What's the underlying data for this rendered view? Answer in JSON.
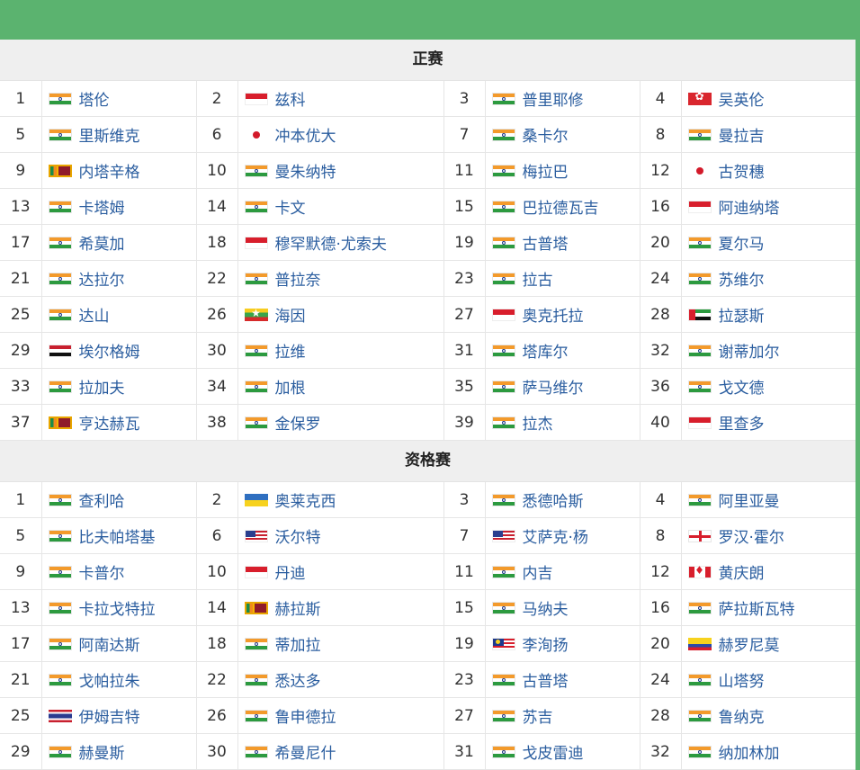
{
  "main_draw": {
    "title": "正赛",
    "players": [
      {
        "seed": "1",
        "name": "塔伦",
        "flag": "india"
      },
      {
        "seed": "2",
        "name": "兹科",
        "flag": "indonesia"
      },
      {
        "seed": "3",
        "name": "普里耶修",
        "flag": "india"
      },
      {
        "seed": "4",
        "name": "吴英伦",
        "flag": "hongkong"
      },
      {
        "seed": "5",
        "name": "里斯维克",
        "flag": "india"
      },
      {
        "seed": "6",
        "name": "冲本优大",
        "flag": "japan"
      },
      {
        "seed": "7",
        "name": "桑卡尔",
        "flag": "india"
      },
      {
        "seed": "8",
        "name": "曼拉吉",
        "flag": "india"
      },
      {
        "seed": "9",
        "name": "内塔辛格",
        "flag": "srilanka"
      },
      {
        "seed": "10",
        "name": "曼朱纳特",
        "flag": "india"
      },
      {
        "seed": "11",
        "name": "梅拉巴",
        "flag": "india"
      },
      {
        "seed": "12",
        "name": "古贺穗",
        "flag": "japan"
      },
      {
        "seed": "13",
        "name": "卡塔姆",
        "flag": "india"
      },
      {
        "seed": "14",
        "name": "卡文",
        "flag": "india"
      },
      {
        "seed": "15",
        "name": "巴拉德瓦吉",
        "flag": "india"
      },
      {
        "seed": "16",
        "name": "阿迪纳塔",
        "flag": "indonesia"
      },
      {
        "seed": "17",
        "name": "希莫加",
        "flag": "india"
      },
      {
        "seed": "18",
        "name": "穆罕默德·尤索夫",
        "flag": "indonesia"
      },
      {
        "seed": "19",
        "name": "古普塔",
        "flag": "india"
      },
      {
        "seed": "20",
        "name": "夏尔马",
        "flag": "india"
      },
      {
        "seed": "21",
        "name": "达拉尔",
        "flag": "india"
      },
      {
        "seed": "22",
        "name": "普拉奈",
        "flag": "india"
      },
      {
        "seed": "23",
        "name": "拉古",
        "flag": "india"
      },
      {
        "seed": "24",
        "name": "苏维尔",
        "flag": "india"
      },
      {
        "seed": "25",
        "name": "达山",
        "flag": "india"
      },
      {
        "seed": "26",
        "name": "海因",
        "flag": "myanmar"
      },
      {
        "seed": "27",
        "name": "奥克托拉",
        "flag": "indonesia"
      },
      {
        "seed": "28",
        "name": "拉瑟斯",
        "flag": "uae"
      },
      {
        "seed": "29",
        "name": "埃尔格姆",
        "flag": "egypt"
      },
      {
        "seed": "30",
        "name": "拉维",
        "flag": "india"
      },
      {
        "seed": "31",
        "name": "塔库尔",
        "flag": "india"
      },
      {
        "seed": "32",
        "name": "谢蒂加尔",
        "flag": "india"
      },
      {
        "seed": "33",
        "name": "拉加夫",
        "flag": "india"
      },
      {
        "seed": "34",
        "name": "加根",
        "flag": "india"
      },
      {
        "seed": "35",
        "name": "萨马维尔",
        "flag": "india"
      },
      {
        "seed": "36",
        "name": "戈文德",
        "flag": "india"
      },
      {
        "seed": "37",
        "name": "亨达赫瓦",
        "flag": "srilanka"
      },
      {
        "seed": "38",
        "name": "金保罗",
        "flag": "india"
      },
      {
        "seed": "39",
        "name": "拉杰",
        "flag": "india"
      },
      {
        "seed": "40",
        "name": "里查多",
        "flag": "indonesia"
      }
    ]
  },
  "qualifying": {
    "title": "资格赛",
    "players": [
      {
        "seed": "1",
        "name": "查利哈",
        "flag": "india"
      },
      {
        "seed": "2",
        "name": "奥莱克西",
        "flag": "ukraine"
      },
      {
        "seed": "3",
        "name": "悉德哈斯",
        "flag": "india"
      },
      {
        "seed": "4",
        "name": "阿里亚曼",
        "flag": "india"
      },
      {
        "seed": "5",
        "name": "比夫帕塔基",
        "flag": "india"
      },
      {
        "seed": "6",
        "name": "沃尔特",
        "flag": "usa"
      },
      {
        "seed": "7",
        "name": "艾萨克·杨",
        "flag": "usa"
      },
      {
        "seed": "8",
        "name": "罗汉·霍尔",
        "flag": "england"
      },
      {
        "seed": "9",
        "name": "卡普尔",
        "flag": "india"
      },
      {
        "seed": "10",
        "name": "丹迪",
        "flag": "indonesia"
      },
      {
        "seed": "11",
        "name": "内吉",
        "flag": "india"
      },
      {
        "seed": "12",
        "name": "黄庆朗",
        "flag": "canada"
      },
      {
        "seed": "13",
        "name": "卡拉戈特拉",
        "flag": "india"
      },
      {
        "seed": "14",
        "name": "赫拉斯",
        "flag": "srilanka"
      },
      {
        "seed": "15",
        "name": "马纳夫",
        "flag": "india"
      },
      {
        "seed": "16",
        "name": "萨拉斯瓦特",
        "flag": "india"
      },
      {
        "seed": "17",
        "name": "阿南达斯",
        "flag": "india"
      },
      {
        "seed": "18",
        "name": "蒂加拉",
        "flag": "india"
      },
      {
        "seed": "19",
        "name": "李洵扬",
        "flag": "malaysia"
      },
      {
        "seed": "20",
        "name": "赫罗尼莫",
        "flag": "colombia"
      },
      {
        "seed": "21",
        "name": "戈帕拉朱",
        "flag": "india"
      },
      {
        "seed": "22",
        "name": "悉达多",
        "flag": "india"
      },
      {
        "seed": "23",
        "name": "古普塔",
        "flag": "india"
      },
      {
        "seed": "24",
        "name": "山塔努",
        "flag": "india"
      },
      {
        "seed": "25",
        "name": "伊姆吉特",
        "flag": "thailand"
      },
      {
        "seed": "26",
        "name": "鲁申德拉",
        "flag": "india"
      },
      {
        "seed": "27",
        "name": "苏吉",
        "flag": "india"
      },
      {
        "seed": "28",
        "name": "鲁纳克",
        "flag": "india"
      },
      {
        "seed": "29",
        "name": "赫曼斯",
        "flag": "india"
      },
      {
        "seed": "30",
        "name": "希曼尼什",
        "flag": "india"
      },
      {
        "seed": "31",
        "name": "戈皮雷迪",
        "flag": "india"
      },
      {
        "seed": "32",
        "name": "纳加林加",
        "flag": "india"
      }
    ]
  }
}
